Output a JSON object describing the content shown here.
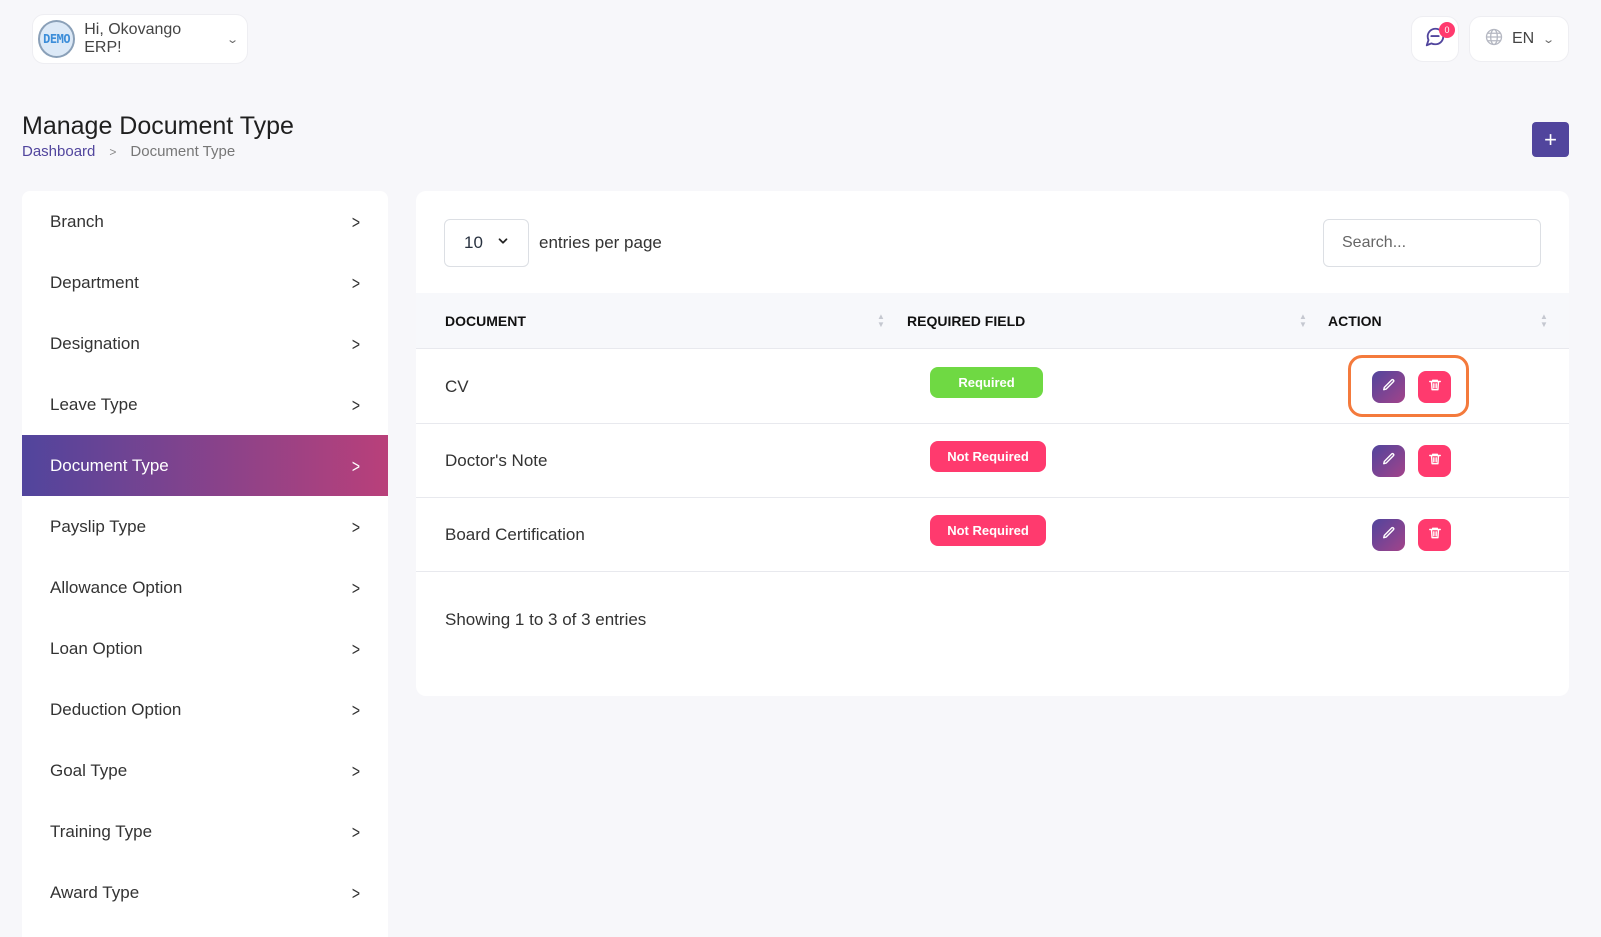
{
  "header": {
    "avatar_text": "DEMO",
    "greeting": "Hi, Okovango ERP!",
    "notification_count": "0",
    "language": "EN"
  },
  "page": {
    "title": "Manage Document Type",
    "breadcrumb": {
      "home": "Dashboard",
      "current": "Document Type"
    },
    "add_label": "+"
  },
  "sidebar": {
    "items": [
      {
        "label": "Branch"
      },
      {
        "label": "Department"
      },
      {
        "label": "Designation"
      },
      {
        "label": "Leave Type"
      },
      {
        "label": "Document Type",
        "active": true
      },
      {
        "label": "Payslip Type"
      },
      {
        "label": "Allowance Option"
      },
      {
        "label": "Loan Option"
      },
      {
        "label": "Deduction Option"
      },
      {
        "label": "Goal Type"
      },
      {
        "label": "Training Type"
      },
      {
        "label": "Award Type"
      }
    ]
  },
  "table": {
    "per_page": "10",
    "per_page_label": "entries per page",
    "search_placeholder": "Search...",
    "columns": [
      "DOCUMENT",
      "REQUIRED FIELD",
      "ACTION"
    ],
    "rows": [
      {
        "document": "CV",
        "required": "Required"
      },
      {
        "document": "Doctor's Note",
        "required": "Not Required"
      },
      {
        "document": "Board Certification",
        "required": "Not Required"
      }
    ],
    "footer": "Showing 1 to 3 of 3 entries"
  },
  "colors": {
    "primary": "#51459d",
    "success": "#6fd943",
    "danger": "#ff3a6e",
    "highlight": "#f47a3c"
  }
}
